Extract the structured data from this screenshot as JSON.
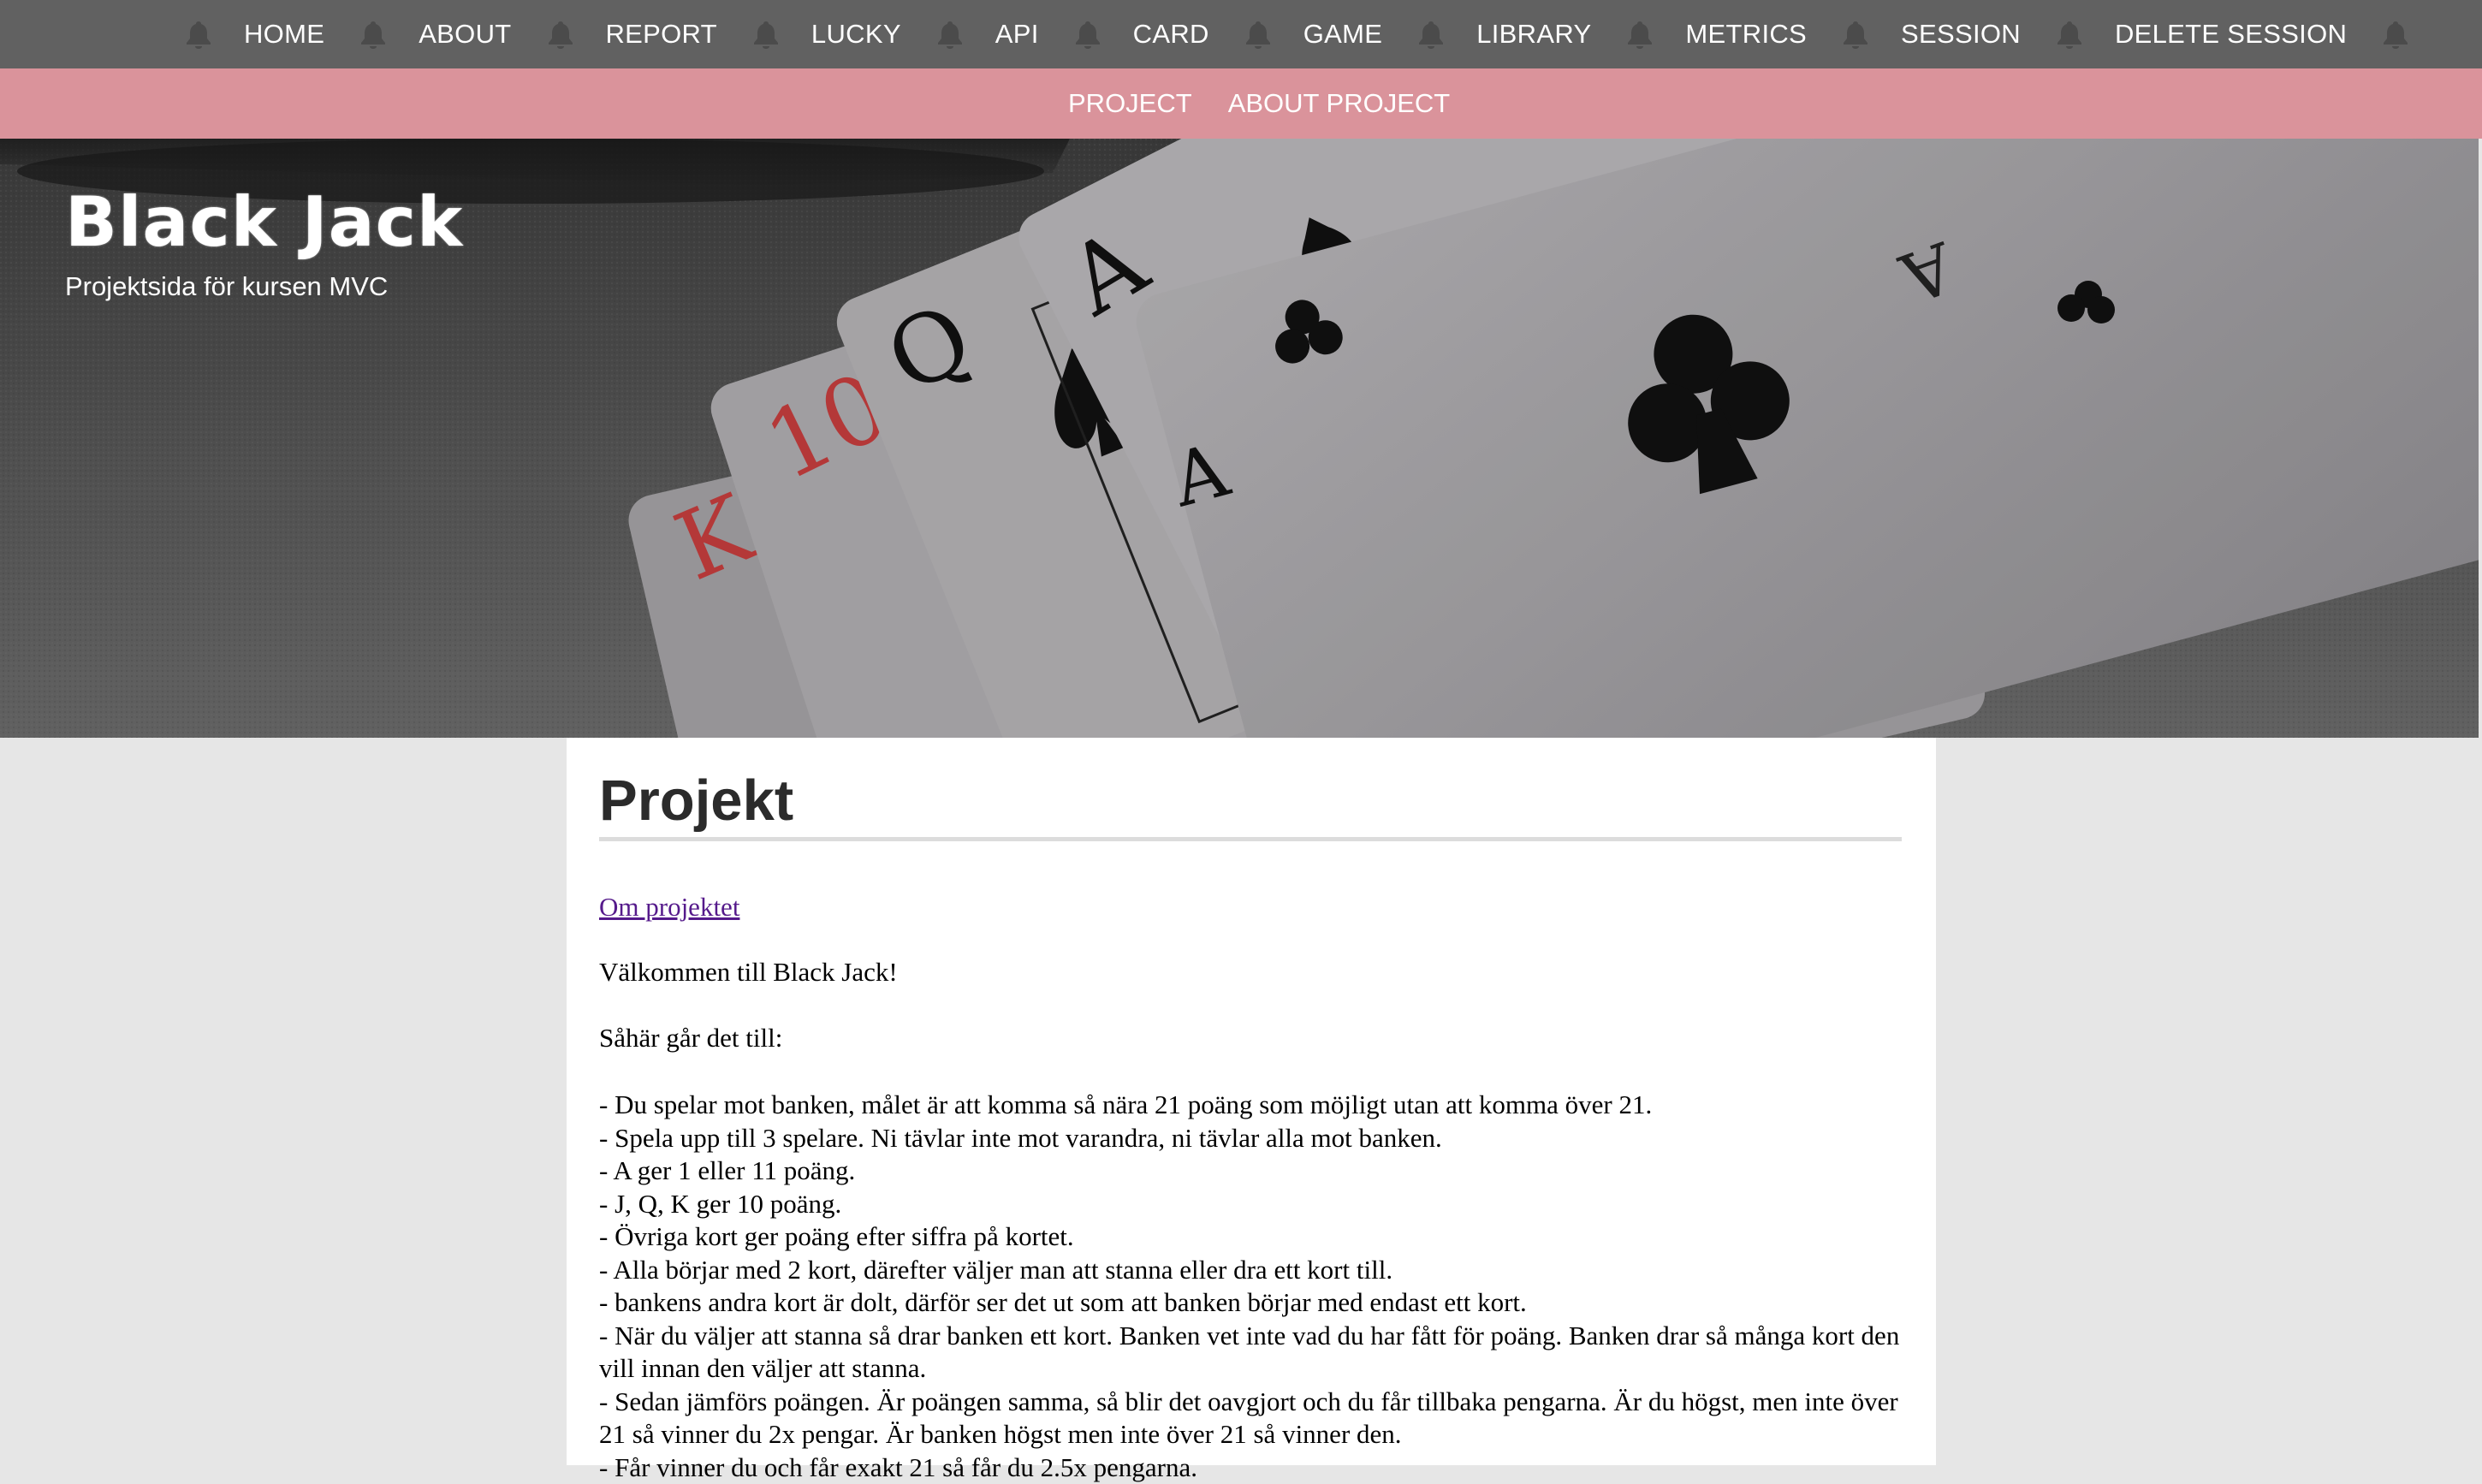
{
  "nav": {
    "items": [
      {
        "label": "HOME"
      },
      {
        "label": "ABOUT"
      },
      {
        "label": "REPORT"
      },
      {
        "label": "LUCKY"
      },
      {
        "label": "API"
      },
      {
        "label": "CARD"
      },
      {
        "label": "GAME"
      },
      {
        "label": "LIBRARY"
      },
      {
        "label": "METRICS"
      },
      {
        "label": "SESSION"
      },
      {
        "label": "DELETE SESSION"
      }
    ],
    "separator_icon": "bell-icon"
  },
  "subnav": {
    "items": [
      {
        "label": "PROJECT"
      },
      {
        "label": "ABOUT PROJECT"
      }
    ]
  },
  "hero": {
    "title": "Black Jack",
    "subtitle": "Projektsida för kursen MVC"
  },
  "main": {
    "title": "Projekt",
    "about_link": "Om projektet",
    "welcome": "Välkommen till Black Jack!",
    "howto": "Såhär går det till:",
    "rules": [
      "- Du spelar mot banken, målet är att komma så nära 21 poäng som möjligt utan att komma över 21.",
      "- Spela upp till 3 spelare. Ni tävlar inte mot varandra, ni tävlar alla mot banken.",
      "- A ger 1 eller 11 poäng.",
      "- J, Q, K ger 10 poäng.",
      "- Övriga kort ger poäng efter siffra på kortet.",
      "- Alla börjar med 2 kort, därefter väljer man att stanna eller dra ett kort till.",
      "- bankens andra kort är dolt, därför ser det ut som att banken börjar med endast ett kort.",
      "- När du väljer att stanna så drar banken ett kort. Banken vet inte vad du har fått för poäng. Banken drar så många kort den vill innan den väljer att stanna.",
      "- Sedan jämförs poängen. Är poängen samma, så blir det oavgjort och du får tillbaka pengarna. Är du högst, men inte över 21 så vinner du 2x pengar. Är banken högst men inte över 21 så vinner den.",
      "- Får vinner du och får exakt 21 så får du 2.5x pengarna."
    ]
  },
  "colors": {
    "topnav_bg": "#616161",
    "subnav_bg": "#da939b",
    "page_bg": "#e6e6e6",
    "link_visited": "#551a8b"
  }
}
